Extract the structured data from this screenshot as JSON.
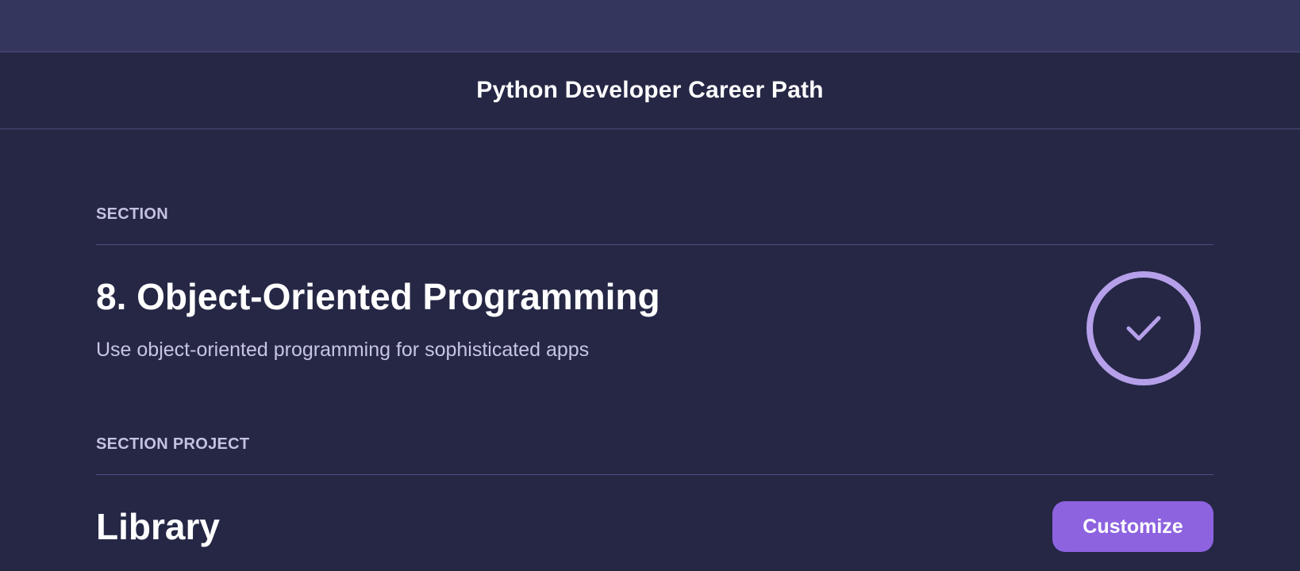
{
  "header": {
    "title": "Python Developer Career Path"
  },
  "section": {
    "kicker": "SECTION",
    "title": "8. Object-Oriented Programming",
    "description": "Use object-oriented programming for sophisticated apps",
    "status_icon": "checkmark-circle-icon"
  },
  "project": {
    "kicker": "SECTION PROJECT",
    "title": "Library",
    "customize_label": "Customize"
  },
  "colors": {
    "background": "#252745",
    "top_bar": "#35365e",
    "accent": "#8d63e0",
    "badge": "#b6a0ea",
    "muted_text": "#c3c3df"
  }
}
